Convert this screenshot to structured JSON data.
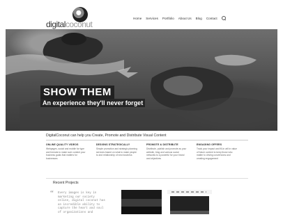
{
  "logo": {
    "part1": "digital",
    "part2": "coconut"
  },
  "nav": {
    "items": [
      "Home",
      "Services",
      "Portfolio",
      "About Us",
      "Blog",
      "Contact"
    ]
  },
  "hero": {
    "title": "SHOW THEM",
    "subtitle": "An experience they'll never forget"
  },
  "intro": {
    "text": "DigitalCoconut can help you Create, Promote and Distribute Visual Content"
  },
  "columns": [
    {
      "title": "ONLINE QUALITY VIDEOS",
      "text": "Webpages, social and mobile for type and formats to make sure content your business goals that matters for businesses"
    },
    {
      "title": "DESIGNS STRATEGICALLY",
      "text": "Simple promotion and strategic planning services based on what to make people to and relationship of new business"
    },
    {
      "title": "PROMOTE & DISTRIBUTE",
      "text": "Distribute, publish and promote as your website, blog and various social networks to a powerful for your brand and objectives"
    },
    {
      "title": "ENGAGING OFFERS",
      "text": "Track your impact and fill-in will in value of future content to keep those who matter to driving conversions and creating engagement"
    }
  ],
  "recent": {
    "heading": "Recent Projects",
    "quote": "Every images is key in marketing our society online, digital coconut has an incredible ability to capture the heart and soul of organizations and"
  },
  "colors": {
    "background": "#ffffff",
    "hero_overlay": "#000000"
  }
}
